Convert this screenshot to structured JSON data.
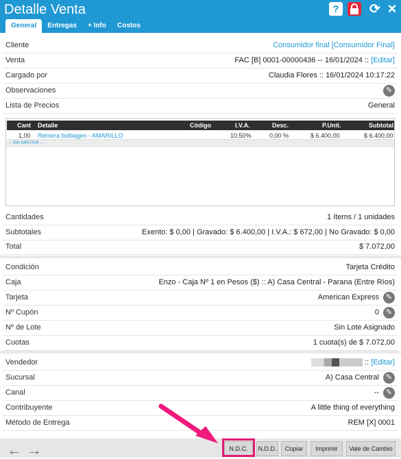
{
  "window": {
    "title": "Detalle Venta"
  },
  "icons": {
    "help": "?",
    "lock": "lock",
    "refresh": "⟳",
    "close": "×"
  },
  "tabs": [
    "General",
    "Entregas",
    "+ Info",
    "Costos"
  ],
  "details": [
    {
      "label": "Cliente",
      "value": "Consumidor final [Consumidor Final]"
    },
    {
      "label": "Venta",
      "value": "FAC [B] 0001-00000436 -- 16/01/2024 :: ",
      "link": "[Editar]"
    },
    {
      "label": "Cargado por",
      "value": "Claudia Flores :: 16/01/2024 10:17:22"
    },
    {
      "label": "Observaciones",
      "value": ""
    },
    {
      "label": "Lista de Precios",
      "value": "General"
    }
  ],
  "table": {
    "headers": [
      "Cant",
      "Detalle",
      "Código",
      "I.V.A.",
      "Desc.",
      "P.Unit.",
      "Subtotal"
    ],
    "rows": [
      [
        "1,00",
        "Remera bolbagen - AMARILLO",
        "",
        "10,50%",
        "0,00 %",
        "$ 6.400,00",
        "$ 6.400,00"
      ]
    ],
    "note": "-- SIN IMPUTAR --"
  },
  "totals": [
    {
      "label": "Cantidades",
      "value": "1 ítems / 1 unidades"
    },
    {
      "label": "Subtotales",
      "value": "Exento: $ 0,00 | Gravado: $ 6.400,00 | I.V.A.: $ 672,00 | No Gravado: $ 0,00"
    },
    {
      "label": "Total",
      "value": "$ 7.072,00"
    }
  ],
  "payment": [
    {
      "label": "Condición",
      "value": "Tarjeta Crédito"
    },
    {
      "label": "Caja",
      "value": "Enzo - Caja Nº 1 en Pesos ($) :: A) Casa Central - Parana (Entre Ríos)"
    },
    {
      "label": "Tarjeta",
      "value": "American Express"
    },
    {
      "label": "Nº Cupón",
      "value": "0"
    },
    {
      "label": "Nº de Lote",
      "value": "Sin Lote Asignado"
    },
    {
      "label": "Cuotas",
      "value": "1 cuota(s) de $ 7.072,00"
    }
  ],
  "seller": [
    {
      "label": "Vendedor",
      "value": ":: ",
      "link": "[Editar]"
    },
    {
      "label": "Sucursal",
      "value": "A) Casa Central"
    },
    {
      "label": "Canal",
      "value": "--"
    },
    {
      "label": "Contribuyente",
      "value": "A little thing of everything"
    },
    {
      "label": "Método de Entrega",
      "value": "REM [X] 0001"
    }
  ],
  "footer": {
    "prev": "←",
    "next": "→",
    "buttons": [
      "N.D.C.",
      "N.D.D.",
      "Copiar",
      "Imprimir",
      "Vale de Cambio"
    ]
  }
}
